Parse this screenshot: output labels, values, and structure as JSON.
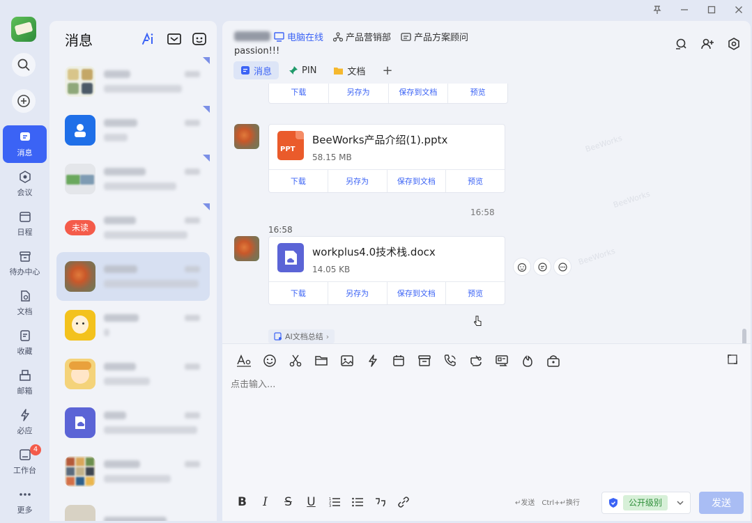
{
  "app": {
    "logo_icon": "app-logo",
    "accent_color": "#3b63f5"
  },
  "rail": {
    "search_icon": "search-icon",
    "add_icon": "add-icon",
    "items": [
      {
        "label": "消息",
        "icon": "message-icon",
        "active": true
      },
      {
        "label": "会议",
        "icon": "meeting-icon"
      },
      {
        "label": "日程",
        "icon": "calendar-icon"
      },
      {
        "label": "待办中心",
        "icon": "todo-icon"
      },
      {
        "label": "文档",
        "icon": "document-icon"
      },
      {
        "label": "收藏",
        "icon": "favorite-icon"
      },
      {
        "label": "邮箱",
        "icon": "mail-icon"
      },
      {
        "label": "必应",
        "icon": "bolt-icon"
      },
      {
        "label": "工作台",
        "icon": "workbench-icon",
        "badge": "4"
      },
      {
        "label": "更多",
        "icon": "more-icon"
      }
    ]
  },
  "conversations": {
    "title": "消息",
    "unread_label": "未读",
    "items": [
      {
        "avatar": "group-photos",
        "pinned": true
      },
      {
        "avatar": "person-blue",
        "pinned": true
      },
      {
        "avatar": "group-landscape",
        "pinned": true
      },
      {
        "avatar": "unread",
        "pinned": true,
        "unread": true
      },
      {
        "avatar": "mascot-orange",
        "active": true
      },
      {
        "avatar": "monkey-yellow"
      },
      {
        "avatar": "anime-girl"
      },
      {
        "avatar": "doc-purple"
      },
      {
        "avatar": "group-collage"
      },
      {
        "avatar": "group-collage-2"
      }
    ]
  },
  "chat_header": {
    "status": "电脑在线",
    "department": "产品营销部",
    "role": "产品方案顾问",
    "signature": "passion!!!",
    "tabs": [
      {
        "label": "消息",
        "active": true
      },
      {
        "label": "PIN"
      },
      {
        "label": "文档"
      }
    ],
    "add_tab": "+"
  },
  "messages": {
    "actions": [
      "下载",
      "另存为",
      "保存到文档",
      "预览"
    ],
    "files": [
      {
        "name": "BeeWorks产品介绍(1).pptx",
        "size": "58.15 MB",
        "type": "PPT"
      },
      {
        "name": "workplus4.0技术栈.docx",
        "size": "14.05 KB",
        "type": "DOC"
      }
    ],
    "time_divider": "16:58",
    "message_time": "16:58",
    "ai_summary": "AI文档总结",
    "watermark": "BeeWorks"
  },
  "editor": {
    "placeholder": "点击输入...",
    "hint_send": "↵发送",
    "hint_newline": "Ctrl+↵换行",
    "security_level": "公开级别",
    "send_label": "发送"
  }
}
